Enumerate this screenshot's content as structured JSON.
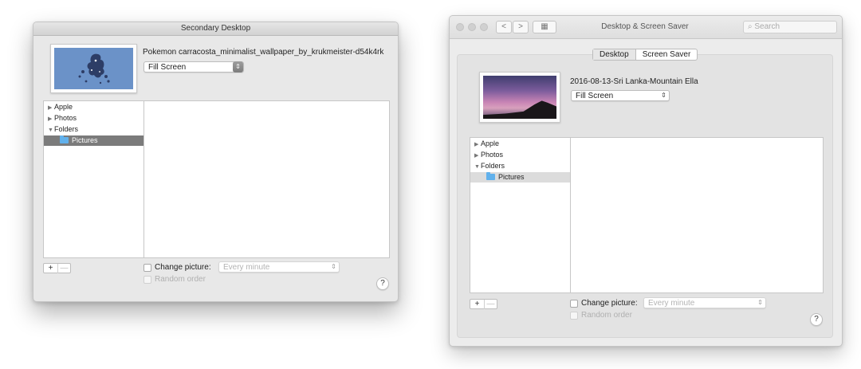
{
  "left_window": {
    "title": "Secondary Desktop",
    "image_name": "Pokemon carracosta_minimalist_wallpaper_by_krukmeister-d54k4rk",
    "fit_popup": "Fill Screen",
    "source_list": [
      {
        "label": "Apple",
        "disclosure": "▶"
      },
      {
        "label": "Photos",
        "disclosure": "▶"
      },
      {
        "label": "Folders",
        "disclosure": "▼"
      }
    ],
    "selected_folder": "Pictures",
    "add_label": "+",
    "remove_label": "—",
    "change_picture_label": "Change picture:",
    "interval_popup": "Every minute",
    "random_order_label": "Random order",
    "help_label": "?"
  },
  "right_window": {
    "title": "Desktop & Screen Saver",
    "search_placeholder": "Search",
    "back_label": "<",
    "forward_label": ">",
    "grid_label": "▦",
    "tabs": [
      {
        "label": "Desktop",
        "selected": true
      },
      {
        "label": "Screen Saver",
        "selected": false
      }
    ],
    "image_name": "2016-08-13-Sri Lanka-Mountain Ella",
    "fit_popup": "Fill Screen",
    "source_list": [
      {
        "label": "Apple",
        "disclosure": "▶"
      },
      {
        "label": "Photos",
        "disclosure": "▶"
      },
      {
        "label": "Folders",
        "disclosure": "▼"
      }
    ],
    "selected_folder": "Pictures",
    "add_label": "+",
    "remove_label": "—",
    "change_picture_label": "Change picture:",
    "interval_popup": "Every minute",
    "random_order_label": "Random order",
    "help_label": "?"
  },
  "colors": {
    "selected_row_left": "#7b7b7b",
    "selected_row_right": "#dcdcdc",
    "folder_icon": "#61b1ec",
    "thumbnail_left": "#6b92c8"
  },
  "icons": {
    "popup_arrows": "⇕",
    "folder": "folder-icon",
    "search": "search-icon"
  }
}
